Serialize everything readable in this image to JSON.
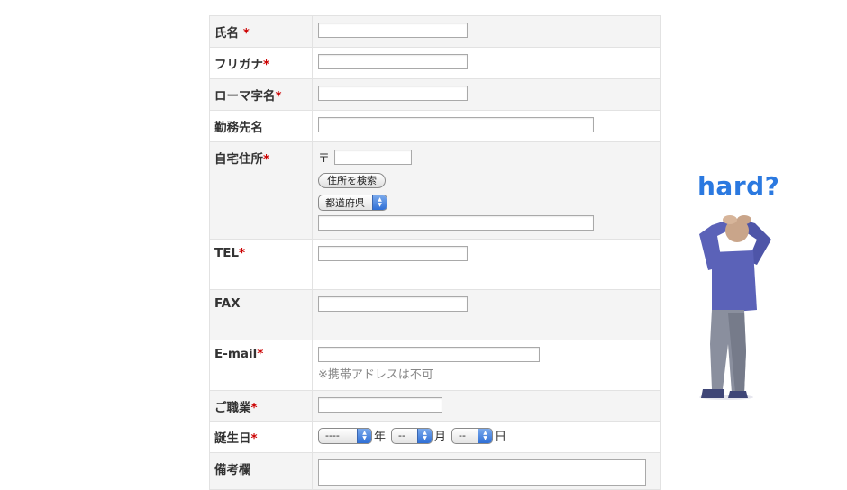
{
  "required_mark": "*",
  "fields": {
    "name": {
      "label": "氏名",
      "required_mark": " *"
    },
    "furigana": {
      "label": "フリガナ"
    },
    "romaji": {
      "label": "ローマ字名"
    },
    "employer": {
      "label": "勤務先名"
    },
    "address": {
      "label": "自宅住所",
      "postal_mark": "〒",
      "search_button": "住所を検索",
      "prefecture_select": "都道府県"
    },
    "tel": {
      "label": "TEL"
    },
    "fax": {
      "label": "FAX"
    },
    "email": {
      "label": "E-mail",
      "note": "※携帯アドレスは不可"
    },
    "occupation": {
      "label": "ご職業"
    },
    "birthday": {
      "label": "誕生日",
      "year_select": "----",
      "month_select": "--",
      "day_select": "--",
      "year_unit": "年",
      "month_unit": "月",
      "day_unit": "日"
    },
    "remarks": {
      "label": "備考欄"
    }
  },
  "caption": "hard?",
  "colors": {
    "accent": "#2b79e0",
    "required": "#cc0000",
    "row_alt": "#f4f4f4",
    "person_shirt": "#5b62b8",
    "person_pants": "#8a8f9e"
  }
}
